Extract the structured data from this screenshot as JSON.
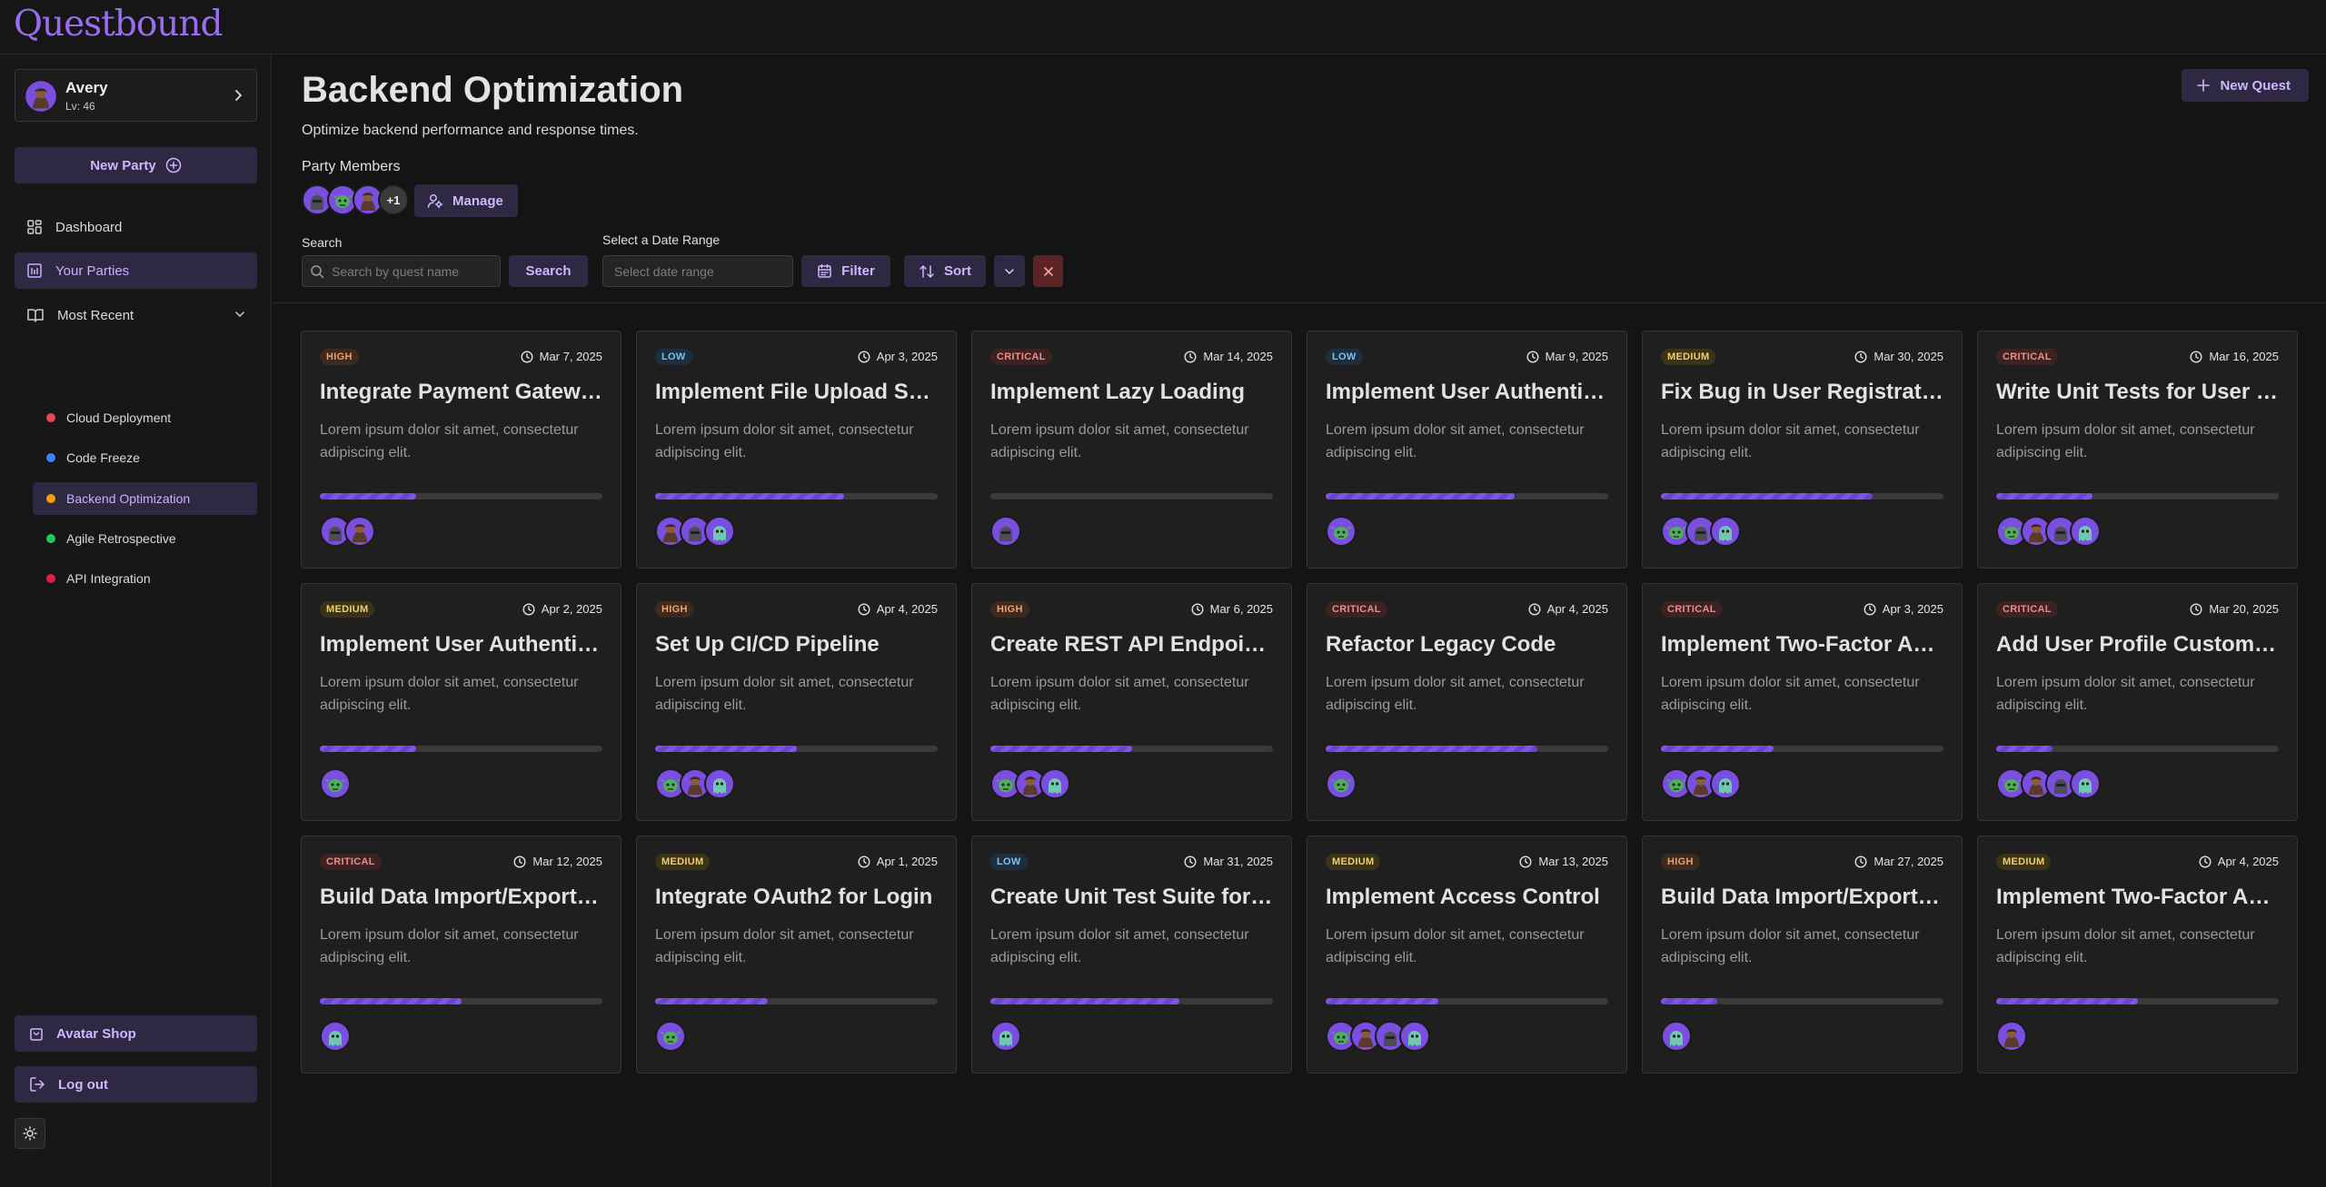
{
  "app": {
    "logo": "Questbound"
  },
  "user": {
    "name": "Avery",
    "level": "Lv: 46"
  },
  "sidebar": {
    "new_party_label": "New Party",
    "nav": [
      {
        "label": "Dashboard",
        "icon": "grid-icon"
      },
      {
        "label": "Your Parties",
        "icon": "parties-icon"
      },
      {
        "label": "Most Recent",
        "icon": "book-icon"
      }
    ],
    "parties": [
      {
        "label": "Cloud Deployment",
        "color": "#e5484d"
      },
      {
        "label": "Code Freeze",
        "color": "#3b82f6"
      },
      {
        "label": "Backend Optimization",
        "color": "#f59e0b"
      },
      {
        "label": "Agile Retrospective",
        "color": "#22c55e"
      },
      {
        "label": "API Integration",
        "color": "#e11d48"
      }
    ],
    "avatar_shop_label": "Avatar Shop",
    "logout_label": "Log out"
  },
  "header": {
    "title": "Backend Optimization",
    "subtitle": "Optimize backend performance and response times.",
    "new_quest_label": "New Quest",
    "party_members_label": "Party Members",
    "extra_members": "+1",
    "manage_label": "Manage"
  },
  "filters": {
    "search_label": "Search",
    "search_placeholder": "Search by quest name",
    "search_button": "Search",
    "date_label": "Select a Date Range",
    "date_placeholder": "Select date range",
    "filter_button": "Filter",
    "sort_button": "Sort"
  },
  "colors": {
    "accent": "#9a6cf0",
    "button_bg": "#2f2843",
    "clear_bg": "#5b2323"
  },
  "quests": [
    {
      "priority": "HIGH",
      "date": "Mar 7, 2025",
      "title": "Integrate Payment Gateway",
      "desc": "Lorem ipsum dolor sit amet, consectetur adipiscing elit.",
      "progress": 0.34,
      "members": [
        "knight",
        "rogue"
      ]
    },
    {
      "priority": "LOW",
      "date": "Apr 3, 2025",
      "title": "Implement File Upload System",
      "desc": "Lorem ipsum dolor sit amet, consectetur adipiscing elit.",
      "progress": 0.67,
      "members": [
        "rogue",
        "knight",
        "ghost"
      ]
    },
    {
      "priority": "CRITICAL",
      "date": "Mar 14, 2025",
      "title": "Implement Lazy Loading",
      "desc": "Lorem ipsum dolor sit amet, consectetur adipiscing elit.",
      "progress": 0,
      "members": [
        "knight"
      ]
    },
    {
      "priority": "LOW",
      "date": "Mar 9, 2025",
      "title": "Implement User Authentication",
      "desc": "Lorem ipsum dolor sit amet, consectetur adipiscing elit.",
      "progress": 0.67,
      "members": [
        "goblin"
      ]
    },
    {
      "priority": "MEDIUM",
      "date": "Mar 30, 2025",
      "title": "Fix Bug in User Registration",
      "desc": "Lorem ipsum dolor sit amet, consectetur adipiscing elit.",
      "progress": 0.75,
      "members": [
        "goblin",
        "knight",
        "ghost"
      ]
    },
    {
      "priority": "CRITICAL",
      "date": "Mar 16, 2025",
      "title": "Write Unit Tests for User Service",
      "desc": "Lorem ipsum dolor sit amet, consectetur adipiscing elit.",
      "progress": 0.34,
      "members": [
        "goblin",
        "rogue",
        "knight",
        "ghost"
      ]
    },
    {
      "priority": "MEDIUM",
      "date": "Apr 2, 2025",
      "title": "Implement User Authentication",
      "desc": "Lorem ipsum dolor sit amet, consectetur adipiscing elit.",
      "progress": 0.34,
      "members": [
        "goblin"
      ]
    },
    {
      "priority": "HIGH",
      "date": "Apr 4, 2025",
      "title": "Set Up CI/CD Pipeline",
      "desc": "Lorem ipsum dolor sit amet, consectetur adipiscing elit.",
      "progress": 0.5,
      "members": [
        "goblin",
        "rogue",
        "ghost"
      ]
    },
    {
      "priority": "HIGH",
      "date": "Mar 6, 2025",
      "title": "Create REST API Endpoints",
      "desc": "Lorem ipsum dolor sit amet, consectetur adipiscing elit.",
      "progress": 0.5,
      "members": [
        "goblin",
        "rogue",
        "ghost"
      ]
    },
    {
      "priority": "CRITICAL",
      "date": "Apr 4, 2025",
      "title": "Refactor Legacy Code",
      "desc": "Lorem ipsum dolor sit amet, consectetur adipiscing elit.",
      "progress": 0.75,
      "members": [
        "goblin"
      ]
    },
    {
      "priority": "CRITICAL",
      "date": "Apr 3, 2025",
      "title": "Implement Two-Factor Authentication",
      "desc": "Lorem ipsum dolor sit amet, consectetur adipiscing elit.",
      "progress": 0.4,
      "members": [
        "goblin",
        "rogue",
        "ghost"
      ]
    },
    {
      "priority": "CRITICAL",
      "date": "Mar 20, 2025",
      "title": "Add User Profile Customization",
      "desc": "Lorem ipsum dolor sit amet, consectetur adipiscing elit.",
      "progress": 0.2,
      "members": [
        "goblin",
        "rogue",
        "knight",
        "ghost"
      ]
    },
    {
      "priority": "CRITICAL",
      "date": "Mar 12, 2025",
      "title": "Build Data Import/Export Tool",
      "desc": "Lorem ipsum dolor sit amet, consectetur adipiscing elit.",
      "progress": 0.5,
      "members": [
        "ghost"
      ]
    },
    {
      "priority": "MEDIUM",
      "date": "Apr 1, 2025",
      "title": "Integrate OAuth2 for Login",
      "desc": "Lorem ipsum dolor sit amet, consectetur adipiscing elit.",
      "progress": 0.4,
      "members": [
        "goblin"
      ]
    },
    {
      "priority": "LOW",
      "date": "Mar 31, 2025",
      "title": "Create Unit Test Suite for API",
      "desc": "Lorem ipsum dolor sit amet, consectetur adipiscing elit.",
      "progress": 0.67,
      "members": [
        "ghost"
      ]
    },
    {
      "priority": "MEDIUM",
      "date": "Mar 13, 2025",
      "title": "Implement Access Control",
      "desc": "Lorem ipsum dolor sit amet, consectetur adipiscing elit.",
      "progress": 0.4,
      "members": [
        "goblin",
        "rogue",
        "knight",
        "ghost"
      ]
    },
    {
      "priority": "HIGH",
      "date": "Mar 27, 2025",
      "title": "Build Data Import/Export Tool",
      "desc": "Lorem ipsum dolor sit amet, consectetur adipiscing elit.",
      "progress": 0.2,
      "members": [
        "ghost"
      ]
    },
    {
      "priority": "MEDIUM",
      "date": "Apr 4, 2025",
      "title": "Implement Two-Factor Authentication",
      "desc": "Lorem ipsum dolor sit amet, consectetur adipiscing elit.",
      "progress": 0.5,
      "members": [
        "rogue"
      ]
    }
  ]
}
